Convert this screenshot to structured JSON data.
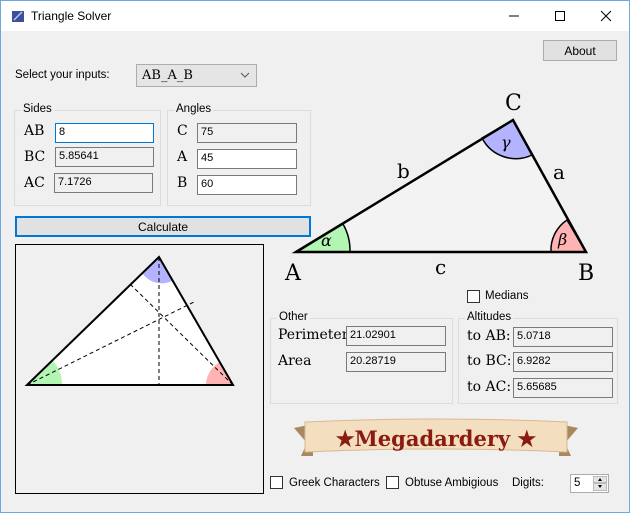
{
  "window": {
    "title": "Triangle Solver",
    "icon": "app-icon",
    "controls": [
      "minimize",
      "maximize",
      "close"
    ]
  },
  "toolbar": {
    "about_label": "About"
  },
  "inputs": {
    "select_label": "Select your inputs:",
    "selected_mode": "AB_A_B"
  },
  "sides": {
    "title": "Sides",
    "rows": [
      {
        "label": "AB",
        "value": "8",
        "editable": true
      },
      {
        "label": "BC",
        "value": "5.85641",
        "editable": false
      },
      {
        "label": "AC",
        "value": "7.1726",
        "editable": false
      }
    ]
  },
  "angles": {
    "title": "Angles",
    "rows": [
      {
        "label": "C",
        "value": "75",
        "editable": false
      },
      {
        "label": "A",
        "value": "45",
        "editable": true
      },
      {
        "label": "B",
        "value": "60",
        "editable": true
      }
    ]
  },
  "calculate_label": "Calculate",
  "diagram": {
    "vertices": {
      "A": "A",
      "B": "B",
      "C": "C"
    },
    "sides": {
      "a": "a",
      "b": "b",
      "c": "c"
    },
    "angles": {
      "alpha": "α",
      "beta": "β",
      "gamma": "γ"
    },
    "colors": {
      "alpha": "#b3f5b3",
      "beta": "#ffb3b3",
      "gamma": "#b3b3ff"
    }
  },
  "medians_label": "Medians",
  "other": {
    "title": "Other",
    "perimeter_label": "Perimeter",
    "perimeter": "21.02901",
    "area_label": "Area",
    "area": "20.28719"
  },
  "altitudes": {
    "title": "Altitudes",
    "rows": [
      {
        "label": "to AB:",
        "value": "5.0718"
      },
      {
        "label": "to BC:",
        "value": "6.9282"
      },
      {
        "label": "to AC:",
        "value": "5.65685"
      }
    ]
  },
  "banner": {
    "text": "★Megadardery ★"
  },
  "footer": {
    "greek_label": "Greek Characters",
    "obtuse_label": "Obtuse Ambigious",
    "digits_label": "Digits:",
    "digits_value": "5"
  }
}
